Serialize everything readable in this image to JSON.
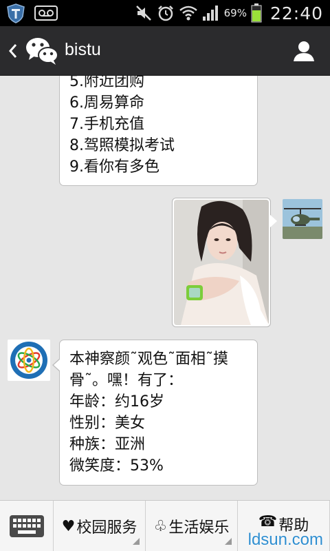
{
  "status_bar": {
    "battery_percent": "69%",
    "time": "22:40",
    "icons": [
      "shield-icon",
      "voicemail-icon",
      "mute-icon",
      "alarm-icon",
      "wifi-icon",
      "signal-icon",
      "battery-icon"
    ]
  },
  "header": {
    "title": "bistu",
    "back_icon": "chevron-left-icon",
    "logo_icon": "wechat-logo-icon",
    "profile_icon": "person-icon"
  },
  "messages": {
    "service_list": {
      "lines": [
        "5.附近团购",
        "6.周易算命",
        "7.手机充值",
        "8.驾照模拟考试",
        "9.看你有多色"
      ]
    },
    "sent_image": {
      "type": "photo"
    },
    "bot_reply": {
      "lines": [
        "本神察颜˜观色˜面相˜摸",
        "骨˜。嘿！有了：",
        "年龄：约16岁",
        "性别：美女",
        "种族：亚洲",
        "微笑度：53%"
      ]
    }
  },
  "bottom_menu": {
    "keyboard_icon": "keyboard-icon",
    "items": [
      {
        "icon": "heart-icon",
        "symbol": "♥",
        "label": "校园服务"
      },
      {
        "icon": "club-icon",
        "symbol": "♧",
        "label": "生活娱乐"
      },
      {
        "icon": "phone-icon",
        "symbol": "☎",
        "label": "帮助"
      }
    ]
  },
  "watermark": "ldsun.com",
  "colors": {
    "status_bar": "#000000",
    "title_bar": "#2b2b2d",
    "chat_background": "#e6e6e6",
    "bubble": "#ffffff",
    "battery": "#9be03a",
    "watermark": "#2f8ed0"
  }
}
